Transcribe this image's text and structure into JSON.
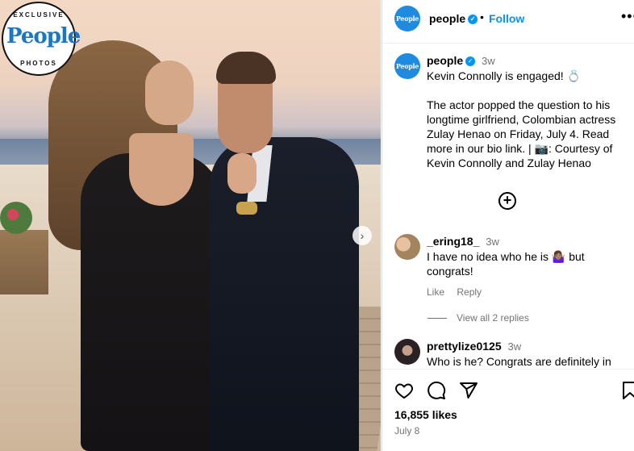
{
  "photo": {
    "badge_top": "EXCLUSIVE",
    "badge_logo": "People",
    "badge_bottom": "PHOTOS"
  },
  "header": {
    "avatar_text": "People",
    "username": "people",
    "follow_label": "Follow",
    "more_label": "•••"
  },
  "caption": {
    "avatar_text": "People",
    "username": "people",
    "time": "3w",
    "line1": "Kevin Connolly is engaged! 💍",
    "line2": "The actor popped the question to his longtime girlfriend, Colombian actress Zulay Henao on Friday, July 4. Read more in our bio link. | 📷: Courtesy of Kevin Connolly and Zulay Henao"
  },
  "comments": [
    {
      "username": "_ering18_",
      "time": "3w",
      "text": "I have no idea who he is 🤷🏽‍♀️ but congrats!",
      "like_label": "Like",
      "reply_label": "Reply",
      "view_replies": "View all 2 replies"
    },
    {
      "username": "prettylize0125",
      "time": "3w",
      "text": "Who is he? Congrats are definitely in"
    }
  ],
  "footer": {
    "likes": "16,855 likes",
    "date": "July 8"
  },
  "colors": {
    "accent": "#0095f6",
    "brand": "#1f8be0",
    "muted": "#737373"
  }
}
